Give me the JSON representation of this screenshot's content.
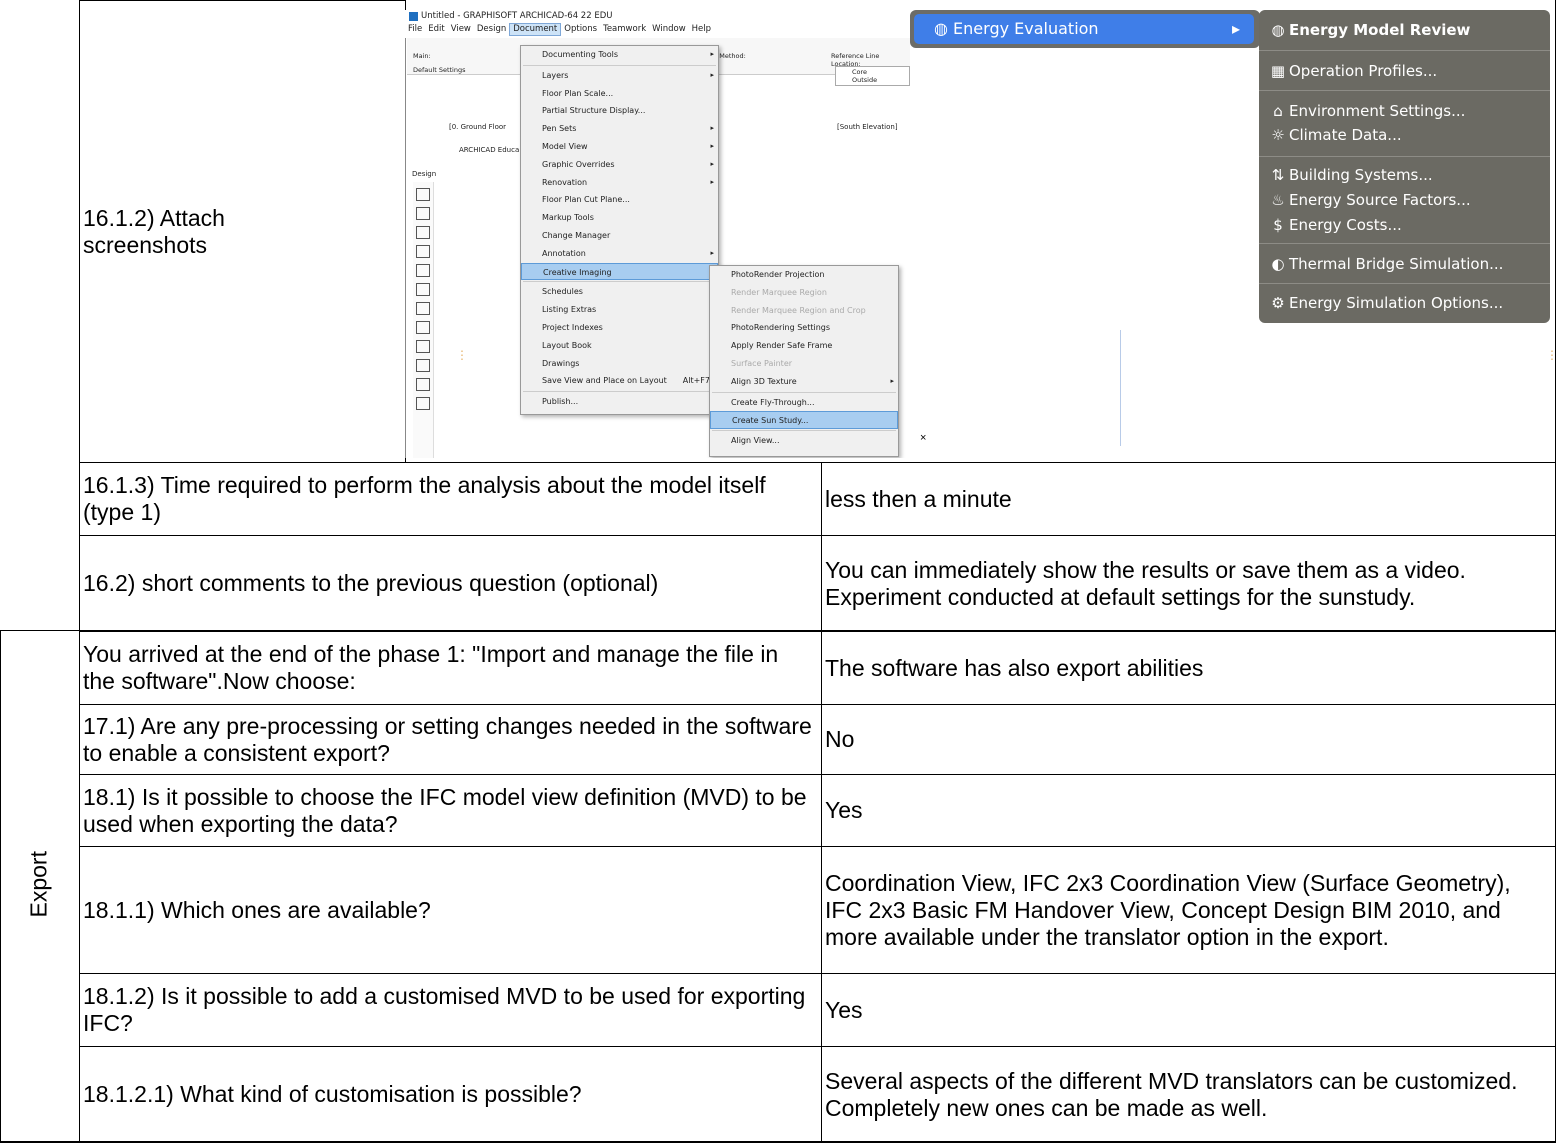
{
  "rows": {
    "r1612": {
      "q": "16.1.2) Attach screenshots"
    },
    "r1613": {
      "q": "16.1.3) Time required to perform the analysis about the model itself (type 1)",
      "a": "less then a minute"
    },
    "r162": {
      "q": "16.2) short comments to the previous question (optional)",
      "a": "You can immediately show the results or save them as a video. Experiment conducted at default settings for the sunstudy."
    },
    "rphase": {
      "q": "You arrived at the end of the phase 1: \"Import and manage the file in the software\".Now choose:",
      "a": "The software has also export abilities"
    },
    "r171": {
      "q": "17.1) Are any pre-processing or setting changes needed in the software to enable a consistent export?",
      "a": "No"
    },
    "r181": {
      "q": "18.1) Is it possible to choose the IFC model view definition (MVD) to be used when exporting the data?",
      "a": "Yes"
    },
    "r1811": {
      "q": "18.1.1) Which ones are available?",
      "a": "Coordination View, IFC 2x3 Coordination View (Surface Geometry), IFC 2x3 Basic FM Handover View, Concept Design BIM 2010, and more available under the translator option in the export."
    },
    "r1812": {
      "q": "18.1.2) Is it possible to add a customised MVD to be used for exporting IFC?",
      "a": "Yes"
    },
    "r18121": {
      "q": "18.1.2.1) What kind of customisation is possible?",
      "a": "Several aspects of the different MVD translators can be customized.\nCompletely new ones can be made as well."
    }
  },
  "section_label": "Export",
  "screenshot": {
    "title": "Untitled - GRAPHISOFT ARCHICAD-64 22 EDU",
    "menubar": [
      "File",
      "Edit",
      "View",
      "Design",
      "Document",
      "Options",
      "Teamwork",
      "Window",
      "Help"
    ],
    "toolbar": {
      "main_label": "Main:",
      "default_settings": "Default Settings",
      "method_label": "ity Method:",
      "ref_line_label": "Reference Line Location:",
      "core_outside": "Core Outside",
      "tab_floor": "[0. Ground Floor",
      "tab_south": "[South Elevation]",
      "edu_text": "ARCHICAD Educa",
      "design_label": "Design"
    },
    "document_menu": [
      "Documenting Tools",
      "Layers",
      "Floor Plan Scale...",
      "Partial Structure Display...",
      "Pen Sets",
      "Model View",
      "Graphic Overrides",
      "Renovation",
      "Floor Plan Cut Plane...",
      "Markup Tools",
      "Change Manager",
      "Annotation",
      "Creative Imaging",
      "Schedules",
      "Listing Extras",
      "Project Indexes",
      "Layout Book",
      "Drawings",
      "Save View and Place on Layout",
      "Publish..."
    ],
    "save_view_shortcut": "Alt+F7",
    "imaging_menu": [
      "PhotoRender Projection",
      "Render Marquee Region",
      "Render Marquee Region and Crop",
      "PhotoRendering Settings",
      "Apply Render Safe Frame",
      "Surface Painter",
      "Align 3D Texture",
      "Create Fly-Through...",
      "Create Sun Study...",
      "Align View..."
    ],
    "close_mark": "×"
  },
  "energy": {
    "main": "Energy Evaluation",
    "items": [
      "Energy Model Review",
      "Operation Profiles...",
      "Environment Settings...",
      "Climate Data...",
      "Building Systems...",
      "Energy Source Factors...",
      "Energy Costs...",
      "Thermal Bridge Simulation...",
      "Energy Simulation Options..."
    ]
  },
  "colors": {
    "menu_highlight": "#3f7ee8",
    "energy_bg": "#6b6a63",
    "selection": "#a8cdf0"
  }
}
